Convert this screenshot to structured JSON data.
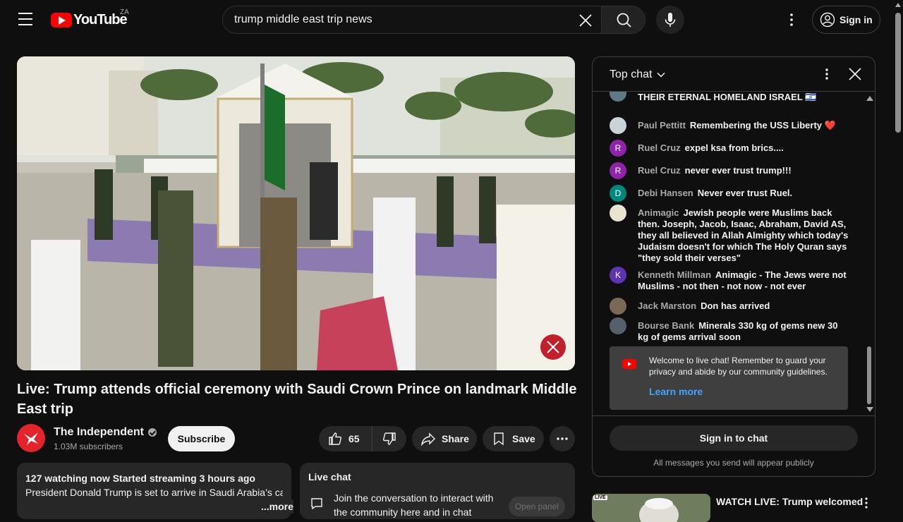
{
  "header": {
    "logo_text": "YouTube",
    "country_code": "ZA",
    "search_value": "trump middle east trip news",
    "signin_label": "Sign in"
  },
  "video": {
    "title": "Live: Trump attends official ceremony with Saudi Crown Prince on landmark Middle East trip"
  },
  "channel": {
    "name": "The Independent",
    "subscribers": "1.03M subscribers",
    "subscribe_label": "Subscribe"
  },
  "actions": {
    "like_count": "65",
    "share_label": "Share",
    "save_label": "Save"
  },
  "description": {
    "meta": "127 watching now  Started streaming 3 hours ago",
    "text": "President Donald Trump is set to arrive in Saudi Arabia’s capital Riyadh this morning as part of a landmark visit",
    "more_label": "...more"
  },
  "live_chat_box": {
    "title": "Live chat",
    "join_text": "Join the conversation to interact with the community here and in chat",
    "open_panel_label": "Open panel"
  },
  "chat": {
    "header_title": "Top chat",
    "messages": [
      {
        "author": "",
        "text": "THEIR ETERNAL HOMELAND ISRAEL 🇮🇱",
        "avatar_letter": "",
        "avatar_color": "#5f7a86"
      },
      {
        "author": "Paul Pettitt",
        "text": "Remembering the USS Liberty ❤️",
        "avatar_letter": "",
        "avatar_color": "#c9d3d8"
      },
      {
        "author": "Ruel Cruz",
        "text": "expel ksa from brics....",
        "avatar_letter": "R",
        "avatar_color": "#8e24aa"
      },
      {
        "author": "Ruel Cruz",
        "text": "never ever trust trump!!!",
        "avatar_letter": "R",
        "avatar_color": "#8e24aa"
      },
      {
        "author": "Debi Hansen",
        "text": "Never ever trust Ruel.",
        "avatar_letter": "D",
        "avatar_color": "#00897b"
      },
      {
        "author": "Animagic",
        "text": "Jewish people were Muslims back then. Joseph, Jacob, Isaac, Abraham, David AS, they all believed in Allah Almighty which today's Judaism doesn't for which The Holy Quran says \"they sold their verses\"",
        "avatar_letter": "",
        "avatar_color": "#e8e4d0"
      },
      {
        "author": "Kenneth Millman",
        "text": "Animagic - The Jews were not Muslims - not then - not now - not ever",
        "avatar_letter": "K",
        "avatar_color": "#5e35b1"
      },
      {
        "author": "Jack Marston",
        "text": "Don has arrived",
        "avatar_letter": "",
        "avatar_color": "#7a6a55"
      },
      {
        "author": "Bourse Bank",
        "text": "Minerals 330 kg of gems new 30 kg of gems arrival soon",
        "avatar_letter": "",
        "avatar_color": "#55606a"
      }
    ],
    "welcome_text": "Welcome to live chat! Remember to guard your privacy and abide by our community guidelines.",
    "learn_more": "Learn more",
    "signin_chat": "Sign in to chat",
    "public_note": "All messages you send will appear publicly"
  },
  "recommendation": {
    "live_badge": "LIVE",
    "title": "WATCH LIVE: Trump welcomed"
  }
}
